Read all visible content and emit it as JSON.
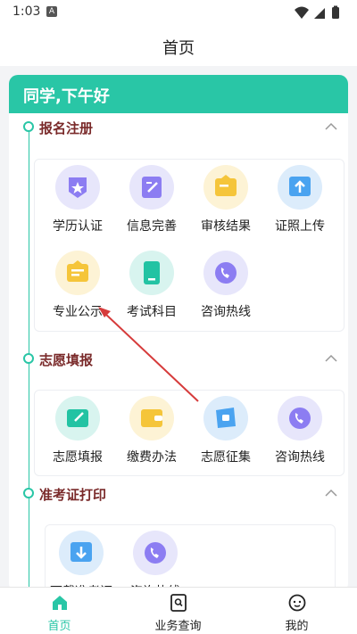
{
  "status_bar": {
    "time": "1:03",
    "badge": "A"
  },
  "header": {
    "title": "首页"
  },
  "greeting": "同学,下午好",
  "sections": [
    {
      "title": "报名注册",
      "items": [
        {
          "label": "学历认证",
          "icon": "shield-star-icon"
        },
        {
          "label": "信息完善",
          "icon": "edit-doc-icon"
        },
        {
          "label": "审核结果",
          "icon": "folder-icon"
        },
        {
          "label": "证照上传",
          "icon": "upload-icon"
        },
        {
          "label": "专业公示",
          "icon": "briefcase-doc-icon"
        },
        {
          "label": "考试科目",
          "icon": "book-icon"
        },
        {
          "label": "咨询热线",
          "icon": "phone-icon"
        }
      ]
    },
    {
      "title": "志愿填报",
      "items": [
        {
          "label": "志愿填报",
          "icon": "pen-paper-icon"
        },
        {
          "label": "缴费办法",
          "icon": "wallet-icon"
        },
        {
          "label": "志愿征集",
          "icon": "collect-icon"
        },
        {
          "label": "咨询热线",
          "icon": "phone-icon"
        }
      ]
    },
    {
      "title": "准考证打印",
      "items": [
        {
          "label": "下载准考证",
          "icon": "download-icon"
        },
        {
          "label": "咨询热线",
          "icon": "phone-icon"
        }
      ]
    }
  ],
  "tabs": [
    {
      "label": "首页",
      "icon": "home-icon",
      "active": true
    },
    {
      "label": "业务查询",
      "icon": "search-doc-icon",
      "active": false
    },
    {
      "label": "我的",
      "icon": "profile-icon",
      "active": false
    }
  ],
  "colors": {
    "accent": "#29c6a6",
    "section_title": "#7a2a2a",
    "annotation_arrow": "#d63b3b"
  }
}
